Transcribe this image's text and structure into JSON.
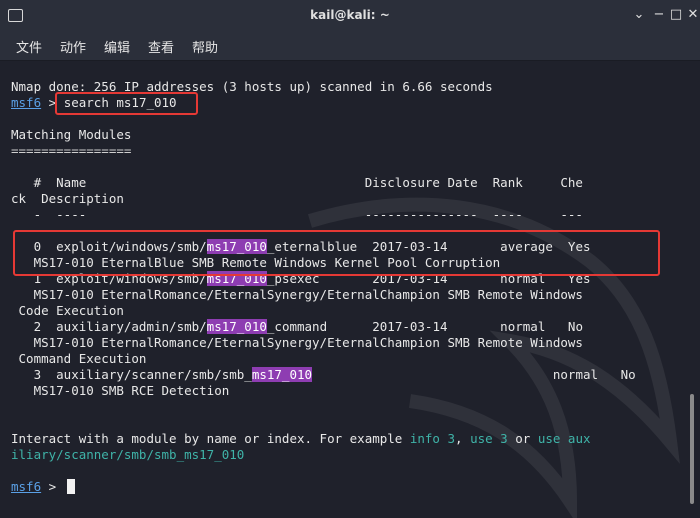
{
  "window": {
    "title": "kail@kali: ~",
    "controls": [
      "⌄",
      "−",
      "□",
      "✕"
    ]
  },
  "menu": [
    "文件",
    "动作",
    "编辑",
    "查看",
    "帮助"
  ],
  "terminal": {
    "nmap_line": "Nmap done: 256 IP addresses (3 hosts up) scanned in 6.66 seconds",
    "prompt": "msf6",
    "prompt_sep": " > ",
    "command": "search ms17_010",
    "matching_title": "Matching Modules",
    "matching_underline": "================",
    "header1": "   #  Name                                     Disclosure Date  Rank     Che",
    "header2": "ck  Description",
    "header_rule": "   -  ----                                     ---------------  ----     ---",
    "results": [
      {
        "pre": "   0  exploit/windows/smb/",
        "hl": "ms17_010",
        "post": "_eternalblue  2017-03-14       average  Yes",
        "desc": [
          "   MS17-010 EternalBlue SMB Remote Windows Kernel Pool Corruption"
        ]
      },
      {
        "pre": "   1  exploit/windows/smb/",
        "hl": "ms17_010",
        "post": "_psexec       2017-03-14       normal   Yes",
        "desc": [
          "   MS17-010 EternalRomance/EternalSynergy/EternalChampion SMB Remote Windows",
          " Code Execution"
        ]
      },
      {
        "pre": "   2  auxiliary/admin/smb/",
        "hl": "ms17_010",
        "post": "_command      2017-03-14       normal   No",
        "desc": [
          "   MS17-010 EternalRomance/EternalSynergy/EternalChampion SMB Remote Windows",
          " Command Execution"
        ]
      },
      {
        "pre": "   3  auxiliary/scanner/smb/smb_",
        "hl": "ms17_010",
        "post": "                                normal   No",
        "desc": [
          "   MS17-010 SMB RCE Detection"
        ]
      }
    ],
    "interact": {
      "prefix": "Interact with a module by name or index. For example ",
      "example1": "info 3",
      "sep1": ", ",
      "example2": "use 3",
      "sep2": " or ",
      "example3a": "use aux",
      "example3b": "iliary/scanner/smb/smb_ms17_010"
    }
  },
  "colors": {
    "background": "#1f212b",
    "prompt": "#5aa0e6",
    "highlight": "#8e3db2",
    "link": "#3fb3a8",
    "annotation": "#e53935"
  }
}
